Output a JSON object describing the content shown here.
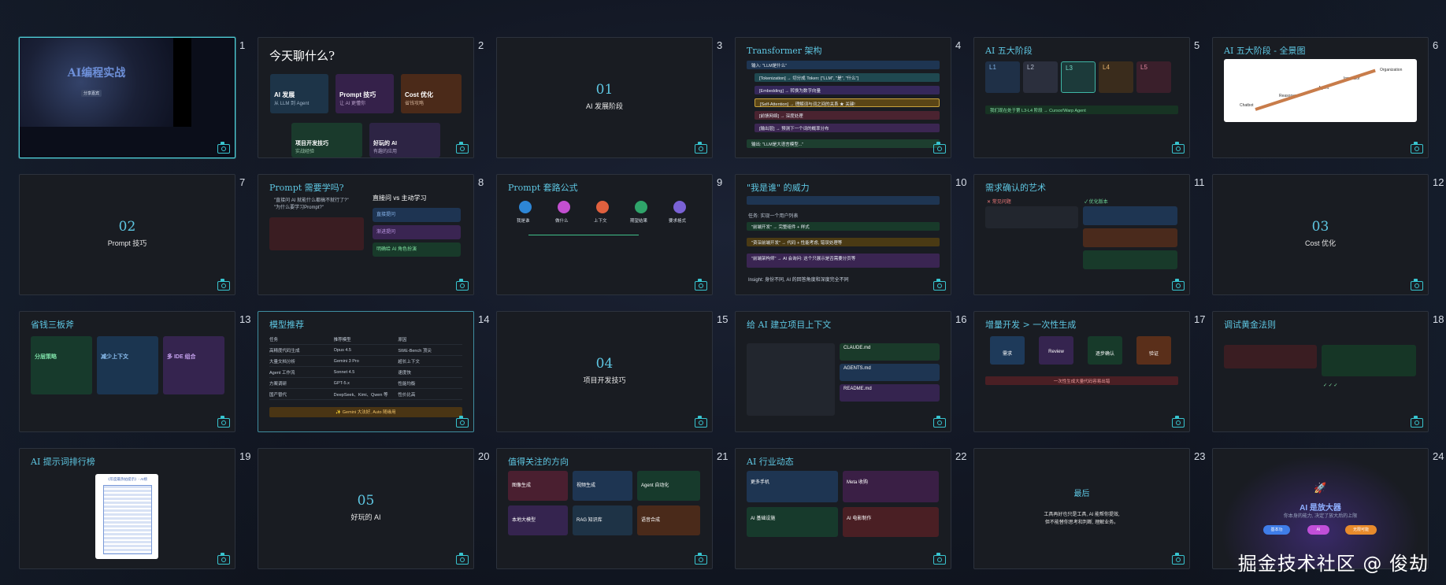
{
  "watermark": "掘金技术社区 @ 俊劫",
  "slides": [
    {
      "num": "1",
      "title": "AI编程实战",
      "tag": "分享嘉宾"
    },
    {
      "num": "2",
      "title": "今天聊什么?",
      "cards": [
        {
          "t": "AI 发展",
          "s": "从 LLM 到 Agent"
        },
        {
          "t": "Prompt 技巧",
          "s": "让 AI 更懂你"
        },
        {
          "t": "Cost 优化",
          "s": "省钱攻略"
        },
        {
          "t": "项目开发技巧",
          "s": "实战经验"
        },
        {
          "t": "好玩的 AI",
          "s": "有趣的应用"
        }
      ]
    },
    {
      "num": "3",
      "secnum": "01",
      "secname": "AI 发展阶段"
    },
    {
      "num": "4",
      "title": "Transformer 架构",
      "rows": [
        "输入: \"LLM是什么\"",
        "[Tokenization] → 切分成 Token: [\"LLM\", \"是\", \"什么\"]",
        "[Embedding] → 转换为数字向量",
        "[Self-Attention] → 理解词与词之间的关系 ★ 关键!",
        "[前馈网络] → 深度处理",
        "[输出层] → 预测下一个词的概率分布",
        "输出: \"LLM是大语言模型...\""
      ]
    },
    {
      "num": "5",
      "title": "AI 五大阶段",
      "stages": [
        "L1",
        "L2",
        "L3",
        "L4",
        "L5"
      ],
      "note": "我们现在处于第 L3-L4 阶段 → Cursor/Warp Agent"
    },
    {
      "num": "6",
      "title": "AI 五大阶段 - 全景图",
      "diagram": [
        "Chatbot",
        "Reasoner",
        "Agent",
        "Innovator",
        "Organization"
      ]
    },
    {
      "num": "7",
      "secnum": "02",
      "secname": "Prompt 技巧"
    },
    {
      "num": "8",
      "title": "Prompt 需要学吗?",
      "sub": "直接问 vs 主动学习",
      "bullets": [
        "\"直接问 AI 就能什么都搞不就行了?\"",
        "\"为什么要学习Prompt?\""
      ],
      "boxes": [
        "直接提问",
        "渐进提问",
        "明确给 AI 角色扮演"
      ]
    },
    {
      "num": "9",
      "title": "Prompt 套路公式",
      "steps": [
        "我是谁",
        "做什么",
        "上下文",
        "期望结果",
        "要求格式"
      ]
    },
    {
      "num": "10",
      "title": "\"我是谁\" 的威力",
      "lines": [
        "任务: 实现一个用户列表",
        "\"前端开发\" → 完整组件 + 样式",
        "\"资深前端开发\" → 代码 + 性能考虑, 错误处理等",
        "\"前端架构师\" → AI 会询问: 这个只展示是否需要分页等",
        "Insight: 身份不同, AI 的回答角度和深度完全不同"
      ]
    },
    {
      "num": "11",
      "title": "需求确认的艺术",
      "bad": "✕ 常见问题",
      "good": "✓ 优化版本"
    },
    {
      "num": "12",
      "secnum": "03",
      "secname": "Cost 优化"
    },
    {
      "num": "13",
      "title": "省钱三板斧",
      "cards": [
        {
          "t": "分层策略"
        },
        {
          "t": "减少上下文"
        },
        {
          "t": "多 IDE 组合"
        }
      ]
    },
    {
      "num": "14",
      "title": "模型推荐",
      "head": [
        "任务",
        "推荐模型",
        "原因"
      ],
      "rows": [
        [
          "高精度代码生成",
          "Opus 4.5",
          "SWE-Bench 顶尖"
        ],
        [
          "大量文档分析",
          "Gemini 3 Pro",
          "超长上下文"
        ],
        [
          "Agent 工作流",
          "Sonnet 4.5",
          "速度快"
        ],
        [
          "方案调研",
          "GPT-5.x",
          "性能均衡"
        ],
        [
          "国产替代",
          "DeepSeek、Kimi、Qwen 等",
          "性价比高"
        ]
      ],
      "foot": "✨ Gemini 大法好, Auto 随缘用"
    },
    {
      "num": "15",
      "secnum": "04",
      "secname": "项目开发技巧"
    },
    {
      "num": "16",
      "title": "给 AI 建立项目上下文",
      "files": [
        "CLAUDE.md",
        "AGENTS.md",
        "README.md"
      ]
    },
    {
      "num": "17",
      "title": "增量开发 > 一次性生成",
      "steps": [
        "需求",
        "Review",
        "逐步确认",
        "验证"
      ],
      "warn": "一次性生成大量代码容易出错"
    },
    {
      "num": "18",
      "title": "调试黄金法则"
    },
    {
      "num": "19",
      "title": "AI 提示词排行榜",
      "img": "《年度最热帖提示》- AI榜"
    },
    {
      "num": "20",
      "secnum": "05",
      "secname": "好玩的 AI"
    },
    {
      "num": "21",
      "title": "值得关注的方向",
      "cards": [
        "图像生成",
        "视频生成",
        "Agent 自动化",
        "本地大模型",
        "RAG 知识库",
        "语音合成"
      ]
    },
    {
      "num": "22",
      "title": "AI 行业动态",
      "cards": [
        "更多手机",
        "Meta 收购",
        "AI 基础设施",
        "AI 电影制作"
      ]
    },
    {
      "num": "23",
      "title": "最后",
      "lines": [
        "工具再好也只是工具, AI 能帮你提效,",
        "但不能替你思考和判断, 理解业务。"
      ]
    },
    {
      "num": "24",
      "title": "AI 是放大器",
      "sub": "你本身的能力, 决定了放大后的上限",
      "pills": [
        "基本功",
        "AI",
        "无限可能"
      ]
    }
  ]
}
